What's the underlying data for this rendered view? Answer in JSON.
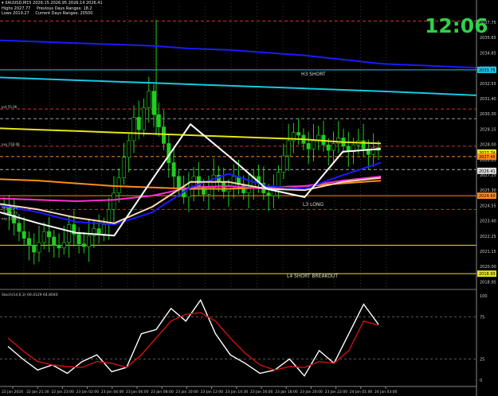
{
  "window": {
    "symbol_timeframe": "XAUUSD,M15",
    "ohlc": "2026.15 2026.95 2026.14 2026.41",
    "info_line1_left": "Highs 2027.77",
    "info_line1_right": "Previous Days Ranges: 18.2",
    "info_line2_left": "Lows 2019.27",
    "info_line2_right": "Current Days Ranges: 20500",
    "clock": "12:06"
  },
  "colors": {
    "background": "#000000",
    "candle": "#22cc22",
    "clock": "#2fd04a",
    "price_axis_bg": "#000000",
    "blue_ma": "#1a1aff",
    "cyan_ma": "#16c9e6",
    "yellow_ma": "#e6e61a",
    "orange_ma": "#ff8c1a",
    "magenta_ma": "#ff2dd2",
    "peach_ma": "#ffd8b0",
    "white_ma": "#ffffff",
    "stoch_main": "#ffffff",
    "stoch_signal": "#d01010"
  },
  "chart_data": [
    {
      "type": "line",
      "title": "XAUUSD,M15",
      "ylim": [
        2017.9,
        2038.6
      ],
      "y_ticks": [
        "2037.75",
        "2035.65",
        "2034.85",
        "2033.70",
        "2032.55",
        "2031.40",
        "2030.30",
        "2029.15",
        "2028.00",
        "2026.85",
        "2027.25",
        "2025.30",
        "2024.55",
        "2023.40",
        "2022.25",
        "2021.15",
        "2020.00",
        "2018.95"
      ],
      "x_labels": [
        "22 Jan 2024",
        "22 Jan 21:30",
        "22 Jan 23:00",
        "23 Jan 02:00",
        "23 Jan 04:00",
        "23 Jan 06:00",
        "23 Jan 08:00",
        "23 Jan 10:00",
        "23 Jan 12:00",
        "23 Jan 14:30",
        "23 Jan 16:00",
        "23 Jan 18:00",
        "23 Jan 20:00",
        "23 Jan 22:00",
        "24 Jan 01:00",
        "24 Jan 03:00"
      ],
      "price_labels": [
        {
          "price": 2033.75,
          "text": "2033.75",
          "bg": "#16c9e6"
        },
        {
          "price": 2027.74,
          "text": "2027.74",
          "bg": "#e6e61a"
        },
        {
          "price": 2027.45,
          "text": "2027.45",
          "bg": "#ff8c1a"
        },
        {
          "price": 2026.41,
          "text": "2026.41",
          "bg": "#dddddd"
        },
        {
          "price": 2024.6,
          "text": "2024.60",
          "bg": "#ff8c1a"
        },
        {
          "price": 2018.93,
          "text": "2018.93",
          "bg": "#e6e61a"
        }
      ],
      "annotations": [
        {
          "text": "H3 SHORT",
          "price": 2033.75
        },
        {
          "text": "L3 LONG",
          "price": 2024.1
        },
        {
          "text": "L4 SHORT BREAKOUT",
          "price": 2018.93
        }
      ],
      "level_labels": [
        "pvt 55.06",
        "nxy 150.06",
        "nxy 78.09",
        "nxy 58.75",
        "nxy 51.00"
      ],
      "horizontal_levels": [
        {
          "price": 2037.3,
          "color": "#cc3333",
          "style": "dash"
        },
        {
          "price": 2033.75,
          "color": "#16c9e6",
          "style": "solid"
        },
        {
          "price": 2030.9,
          "color": "#cc3333",
          "style": "dash"
        },
        {
          "price": 2030.2,
          "color": "#999999",
          "style": "dash"
        },
        {
          "price": 2028.2,
          "color": "#cc3333",
          "style": "dash"
        },
        {
          "price": 2027.45,
          "color": "#ff8c1a",
          "style": "dash"
        },
        {
          "price": 2026.5,
          "color": "#aaaaaa",
          "style": "dash"
        },
        {
          "price": 2024.6,
          "color": "#ff8c1a",
          "style": "solid"
        },
        {
          "price": 2023.6,
          "color": "#cc3333",
          "style": "dash"
        },
        {
          "price": 2021.0,
          "color": "#e6e61a",
          "style": "solid"
        },
        {
          "price": 2018.93,
          "color": "#e6e61a",
          "style": "solid"
        }
      ],
      "series": [
        {
          "color": "#1a1aff",
          "x": [
            0,
            10,
            20,
            30,
            40,
            50,
            60,
            70,
            80,
            90,
            100
          ],
          "y": [
            2035.9,
            2035.8,
            2035.7,
            2035.6,
            2035.5,
            2035.3,
            2035.2,
            2035.0,
            2034.8,
            2034.5,
            2034.2
          ]
        },
        {
          "color": "#16c9e6",
          "x": [
            0,
            10,
            20,
            30,
            40,
            50,
            60,
            70,
            80,
            90,
            100
          ],
          "y": [
            2033.2,
            2033.1,
            2033.0,
            2032.9,
            2032.8,
            2032.7,
            2032.6,
            2032.5,
            2032.4,
            2032.3,
            2032.2
          ]
        },
        {
          "color": "#e6e61a",
          "x": [
            0,
            10,
            20,
            30,
            40,
            50,
            60,
            70,
            80,
            90,
            100
          ],
          "y": [
            2029.5,
            2029.4,
            2029.3,
            2029.2,
            2029.1,
            2029.0,
            2028.9,
            2028.8,
            2028.7,
            2028.5,
            2028.4
          ]
        },
        {
          "color": "#ff8c1a",
          "x": [
            0,
            10,
            20,
            30,
            40,
            50,
            60,
            70,
            80,
            90,
            100
          ],
          "y": [
            2025.8,
            2025.7,
            2025.5,
            2025.3,
            2025.2,
            2025.1,
            2025.1,
            2025.2,
            2025.3,
            2025.5,
            2025.7
          ]
        },
        {
          "color": "#ff2dd2",
          "x": [
            0,
            10,
            20,
            30,
            40,
            50,
            60,
            70,
            80,
            90,
            100
          ],
          "y": [
            2024.4,
            2024.3,
            2024.2,
            2024.3,
            2024.6,
            2025.2,
            2025.3,
            2025.1,
            2025.3,
            2025.7,
            2026.0
          ]
        },
        {
          "color": "#1a1aff",
          "x": [
            0,
            10,
            20,
            30,
            40,
            50,
            60,
            70,
            80,
            90,
            100
          ],
          "y": [
            2023.9,
            2023.4,
            2022.7,
            2022.5,
            2023.4,
            2025.2,
            2026.2,
            2025.3,
            2025.1,
            2026.1,
            2027.0
          ]
        },
        {
          "color": "#ffd8b0",
          "x": [
            0,
            10,
            20,
            30,
            40,
            50,
            60,
            70,
            80,
            90,
            100
          ],
          "y": [
            2024.0,
            2023.6,
            2023.0,
            2022.6,
            2023.8,
            2025.6,
            2025.6,
            2025.1,
            2025.0,
            2025.6,
            2025.9
          ]
        },
        {
          "color": "#ffffff",
          "x": [
            0,
            10,
            20,
            30,
            40,
            50,
            60,
            70,
            80,
            90,
            100
          ],
          "y": [
            2023.4,
            2022.6,
            2021.9,
            2021.7,
            2025.8,
            2029.8,
            2027.5,
            2025.1,
            2024.5,
            2027.8,
            2028.0
          ]
        }
      ],
      "candles_close": [
        2023.8,
        2023.2,
        2022.6,
        2022.0,
        2021.5,
        2021.0,
        2020.5,
        2021.2,
        2022.0,
        2021.6,
        2021.0,
        2020.8,
        2021.2,
        2022.5,
        2021.8,
        2021.1,
        2020.9,
        2021.7,
        2022.2,
        2021.8,
        2022.5,
        2023.6,
        2024.8,
        2025.9,
        2027.4,
        2028.6,
        2030.3,
        2029.4,
        2031.0,
        2032.2,
        2030.5,
        2029.6,
        2028.4,
        2027.0,
        2026.0,
        2025.2,
        2024.5,
        2025.1,
        2026.0,
        2025.3,
        2024.7,
        2025.2,
        2026.1,
        2025.6,
        2024.9,
        2025.3,
        2026.0,
        2025.4,
        2024.8,
        2025.2,
        2026.0,
        2025.5,
        2024.8,
        2024.6,
        2025.1,
        2026.3,
        2027.5,
        2028.6,
        2029.2,
        2029.0,
        2028.4,
        2028.0,
        2028.6,
        2029.0,
        2028.3,
        2027.9,
        2028.4,
        2028.8,
        2028.2,
        2027.8,
        2028.3,
        2028.6,
        2028.0,
        2027.6,
        2028.1,
        2027.9
      ]
    },
    {
      "type": "line",
      "title": "Stoch(14,6,3) 69.4129 64.8040",
      "ylim": [
        0,
        100
      ],
      "y_ticks": [
        "100",
        "75",
        "25",
        "0"
      ],
      "series": [
        {
          "name": "Main",
          "color": "#ffffff",
          "x": [
            0,
            4,
            8,
            12,
            16,
            20,
            24,
            28,
            32,
            36,
            40,
            44,
            48,
            52,
            56,
            60,
            64,
            68,
            72,
            76,
            80,
            84,
            88,
            92,
            96,
            100
          ],
          "y": [
            40,
            25,
            12,
            18,
            8,
            22,
            30,
            10,
            15,
            55,
            60,
            85,
            70,
            95,
            55,
            30,
            20,
            8,
            12,
            25,
            5,
            35,
            20,
            55,
            90,
            66
          ]
        },
        {
          "name": "Signal",
          "color": "#d01010",
          "x": [
            0,
            4,
            8,
            12,
            16,
            20,
            24,
            28,
            32,
            36,
            40,
            44,
            48,
            52,
            56,
            60,
            64,
            68,
            72,
            76,
            80,
            84,
            88,
            92,
            96,
            100
          ],
          "y": [
            50,
            35,
            22,
            18,
            16,
            15,
            22,
            20,
            15,
            30,
            50,
            70,
            78,
            80,
            70,
            50,
            32,
            18,
            12,
            16,
            15,
            22,
            20,
            35,
            70,
            65
          ]
        }
      ]
    }
  ]
}
